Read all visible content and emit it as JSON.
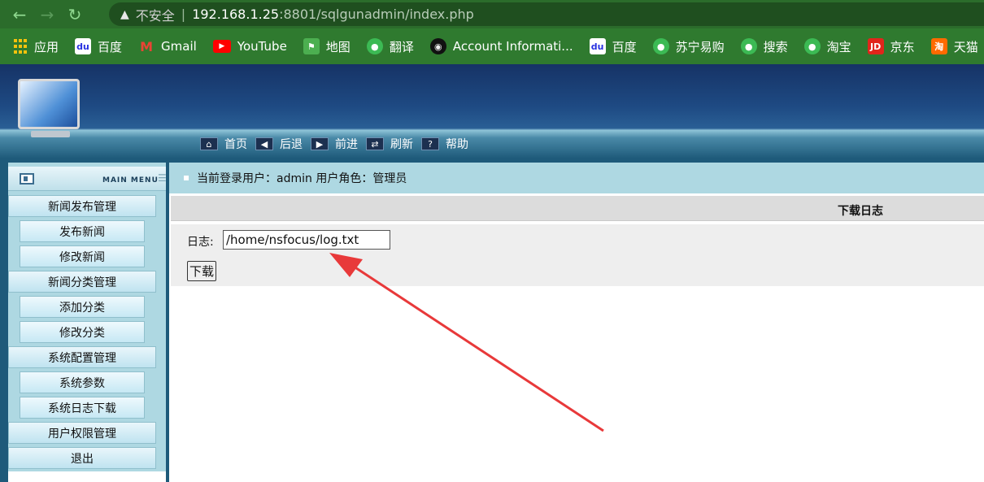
{
  "browser": {
    "security_label": "不安全",
    "separator": "|",
    "url_host": "192.168.1.25",
    "url_rest": ":8801/sqlgunadmin/index.php"
  },
  "bookmarks": [
    {
      "label": "应用",
      "icon": "apps-grid-icon"
    },
    {
      "label": "百度",
      "icon": "baidu-icon"
    },
    {
      "label": "Gmail",
      "icon": "gmail-icon"
    },
    {
      "label": "YouTube",
      "icon": "youtube-icon"
    },
    {
      "label": "地图",
      "icon": "maps-icon"
    },
    {
      "label": "翻译",
      "icon": "globe-icon"
    },
    {
      "label": "Account Informati...",
      "icon": "account-icon"
    },
    {
      "label": "百度",
      "icon": "baidu-icon"
    },
    {
      "label": "苏宁易购",
      "icon": "globe-icon"
    },
    {
      "label": "搜索",
      "icon": "globe-icon"
    },
    {
      "label": "淘宝",
      "icon": "globe-icon"
    },
    {
      "label": "京东",
      "icon": "jd-icon"
    },
    {
      "label": "天猫",
      "icon": "tmall-icon"
    }
  ],
  "toolbar": {
    "home": "首页",
    "back": "后退",
    "forward": "前进",
    "refresh": "刷新",
    "help": "帮助"
  },
  "menu_header": "MAIN MENU",
  "menu": {
    "items": [
      {
        "label": "新闻发布管理",
        "type": "category"
      },
      {
        "label": "发布新闻",
        "type": "sub"
      },
      {
        "label": "修改新闻",
        "type": "sub"
      },
      {
        "label": "新闻分类管理",
        "type": "category"
      },
      {
        "label": "添加分类",
        "type": "sub"
      },
      {
        "label": "修改分类",
        "type": "sub"
      },
      {
        "label": "系统配置管理",
        "type": "category"
      },
      {
        "label": "系统参数",
        "type": "sub"
      },
      {
        "label": "系统日志下载",
        "type": "sub"
      },
      {
        "label": "用户权限管理",
        "type": "category"
      },
      {
        "label": "退出",
        "type": "category"
      }
    ]
  },
  "userbar": {
    "text": "当前登录用户：admin 用户角色：管理员"
  },
  "panel": {
    "title": "下载日志",
    "log_label": "日志:",
    "log_value": "/home/nsfocus/log.txt",
    "download_button": "下载"
  },
  "colors": {
    "annotation_arrow": "#e8393a",
    "sidebar_bg": "#aed8e2"
  }
}
